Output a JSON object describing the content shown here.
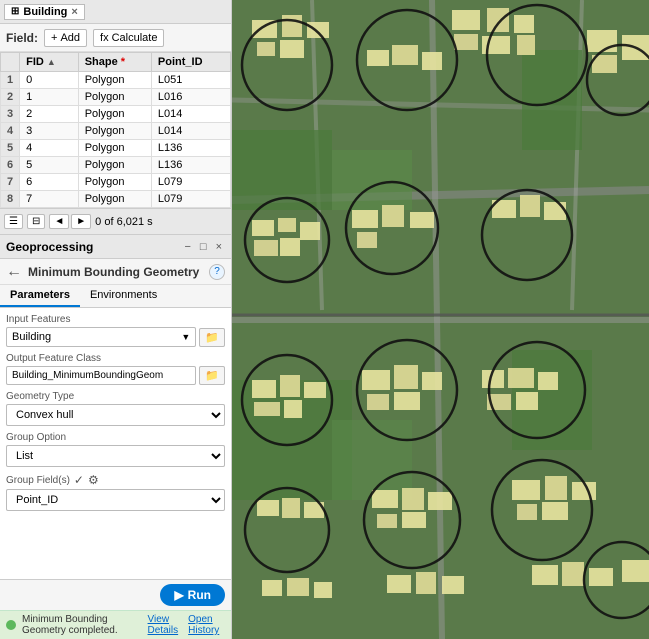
{
  "tab": {
    "title": "Building",
    "close_label": "×"
  },
  "toolbar": {
    "field_label": "Field:",
    "add_label": "Add",
    "calculate_label": "Calculate"
  },
  "table": {
    "columns": [
      "FID",
      "Shape *",
      "Point_ID"
    ],
    "rows": [
      {
        "rownum": "1",
        "fid": "0",
        "shape": "Polygon",
        "point_id": "L051"
      },
      {
        "rownum": "2",
        "fid": "1",
        "shape": "Polygon",
        "point_id": "L016"
      },
      {
        "rownum": "3",
        "fid": "2",
        "shape": "Polygon",
        "point_id": "L014"
      },
      {
        "rownum": "4",
        "fid": "3",
        "shape": "Polygon",
        "point_id": "L014"
      },
      {
        "rownum": "5",
        "fid": "4",
        "shape": "Polygon",
        "point_id": "L136"
      },
      {
        "rownum": "6",
        "fid": "5",
        "shape": "Polygon",
        "point_id": "L136"
      },
      {
        "rownum": "7",
        "fid": "6",
        "shape": "Polygon",
        "point_id": "L079"
      },
      {
        "rownum": "8",
        "fid": "7",
        "shape": "Polygon",
        "point_id": "L079"
      }
    ],
    "footer": {
      "record_count": "0 of 6,021 s"
    }
  },
  "geoprocessing": {
    "panel_title": "Geoprocessing",
    "tool_name": "Minimum Bounding Geometry",
    "tabs": [
      "Parameters",
      "Environments"
    ],
    "active_tab": "Parameters",
    "fields": {
      "input_features_label": "Input Features",
      "input_features_value": "Building",
      "output_feature_class_label": "Output Feature Class",
      "output_feature_class_value": "Building_MinimumBoundingGeom",
      "geometry_type_label": "Geometry Type",
      "geometry_type_value": "Convex hull",
      "group_option_label": "Group Option",
      "group_option_value": "List",
      "group_fields_label": "Group Field(s)",
      "group_field_value": "Point_ID"
    },
    "run_button": "Run",
    "status_message": "Minimum Bounding Geometry completed.",
    "view_details": "View Details",
    "open_history": "Open History"
  },
  "icons": {
    "grid": "⊞",
    "add": "+",
    "calculate": "fx",
    "back": "←",
    "help": "?",
    "close": "×",
    "minimize": "−",
    "prev_page": "◄",
    "next_page": "►",
    "run_play": "▶",
    "folder": "📁",
    "table_view": "☰",
    "column_view": "⊟",
    "settings_gear": "⚙"
  }
}
